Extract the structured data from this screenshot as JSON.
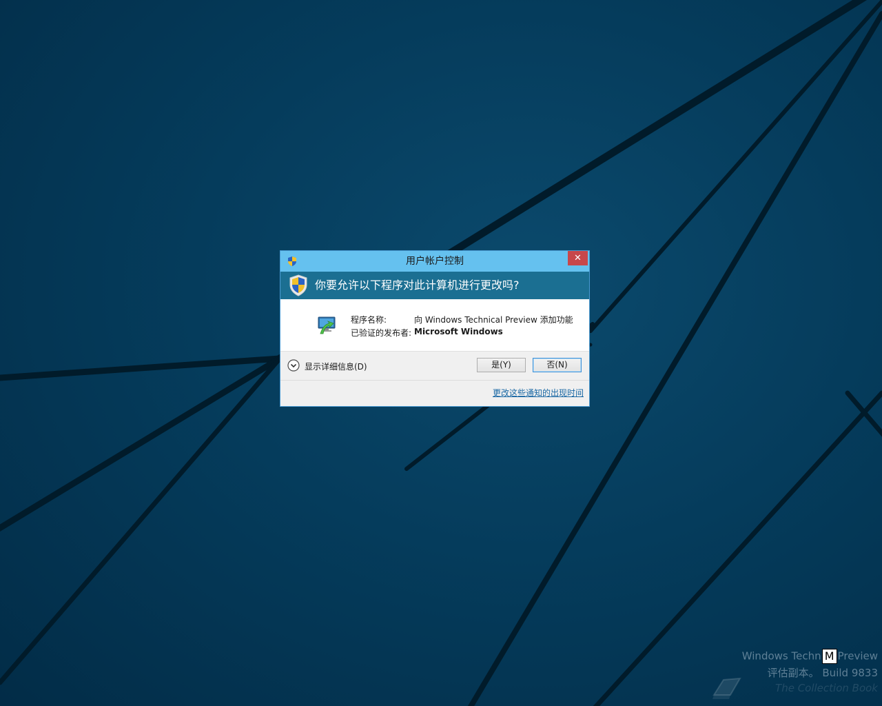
{
  "dialog": {
    "title": "用户帐户控制",
    "close_glyph": "✕",
    "question": "你要允许以下程序对此计算机进行更改吗?",
    "program_label": "程序名称:",
    "program_value": "向 Windows Technical Preview 添加功能",
    "publisher_label": "已验证的发布者:",
    "publisher_value": "Microsoft Windows",
    "details_label": "显示详细信息(D)",
    "yes_label": "是(Y)",
    "no_label": "否(N)",
    "change_link": "更改这些通知的出现时间"
  },
  "watermark": {
    "line1_a": "Windows Techn",
    "line1_cursor": "M",
    "line1_b": "Preview",
    "line2": "评估副本。 Build 9833",
    "line3": "The Collection Book"
  },
  "icons": {
    "title_icon": "uac-shield-icon",
    "header_icon": "uac-shield-icon",
    "program_icon": "add-features-monitor-icon",
    "details_icon": "chevron-down-circle-icon",
    "watermark_icon": "book-icon"
  },
  "colors": {
    "titlebar": "#65c1ef",
    "header_band": "#1b6f92",
    "close_button": "#c7474b",
    "link": "#1766a3",
    "desktop": "#053c5c"
  }
}
